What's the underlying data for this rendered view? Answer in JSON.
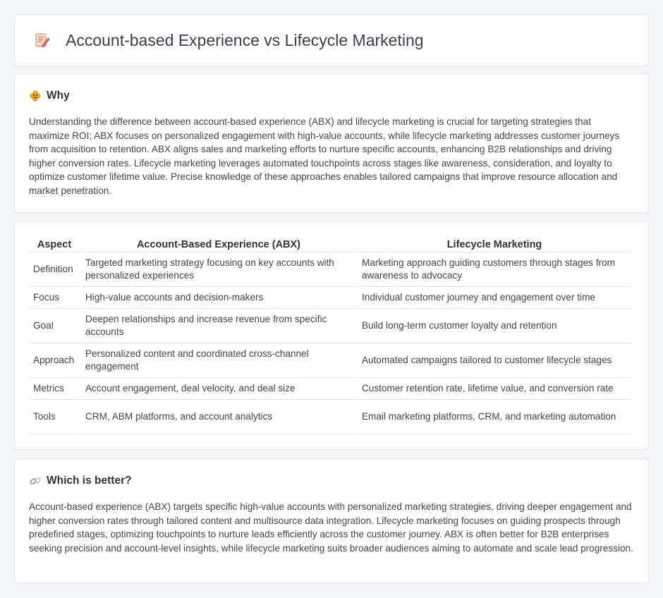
{
  "header": {
    "title": "Account-based Experience vs Lifecycle Marketing",
    "icon": "document-pencil-icon"
  },
  "why": {
    "heading": "Why",
    "icon": "diamond-sign-icon",
    "text": "Understanding the difference between account-based experience (ABX) and lifecycle marketing is crucial for targeting strategies that maximize ROI; ABX focuses on personalized engagement with high-value accounts, while lifecycle marketing addresses customer journeys from acquisition to retention. ABX aligns sales and marketing efforts to nurture specific accounts, enhancing B2B relationships and driving higher conversion rates. Lifecycle marketing leverages automated touchpoints across stages like awareness, consideration, and loyalty to optimize customer lifetime value. Precise knowledge of these approaches enables tailored campaigns that improve resource allocation and market penetration."
  },
  "comparison": {
    "columns": [
      "Aspect",
      "Account-Based Experience (ABX)",
      "Lifecycle Marketing"
    ],
    "rows": [
      [
        "Definition",
        "Targeted marketing strategy focusing on key accounts with personalized experiences",
        "Marketing approach guiding customers through stages from awareness to advocacy"
      ],
      [
        "Focus",
        "High-value accounts and decision-makers",
        "Individual customer journey and engagement over time"
      ],
      [
        "Goal",
        "Deepen relationships and increase revenue from specific accounts",
        "Build long-term customer loyalty and retention"
      ],
      [
        "Approach",
        "Personalized content and coordinated cross-channel engagement",
        "Automated campaigns tailored to customer lifecycle stages"
      ],
      [
        "Metrics",
        "Account engagement, deal velocity, and deal size",
        "Customer retention rate, lifetime value, and conversion rate"
      ],
      [
        "Tools",
        "CRM, ABM platforms, and account analytics",
        "Email marketing platforms, CRM, and marketing automation"
      ]
    ]
  },
  "better": {
    "heading": "Which is better?",
    "icon": "link-icon",
    "text": "Account-based experience (ABX) targets specific high-value accounts with personalized marketing strategies, driving deeper engagement and higher conversion rates through tailored content and multisource data integration. Lifecycle marketing focuses on guiding prospects through predefined stages, optimizing touchpoints to nurture leads efficiently across the customer journey. ABX is often better for B2B enterprises seeking precision and account-level insights, while lifecycle marketing suits broader audiences aiming to automate and scale lead progression."
  }
}
